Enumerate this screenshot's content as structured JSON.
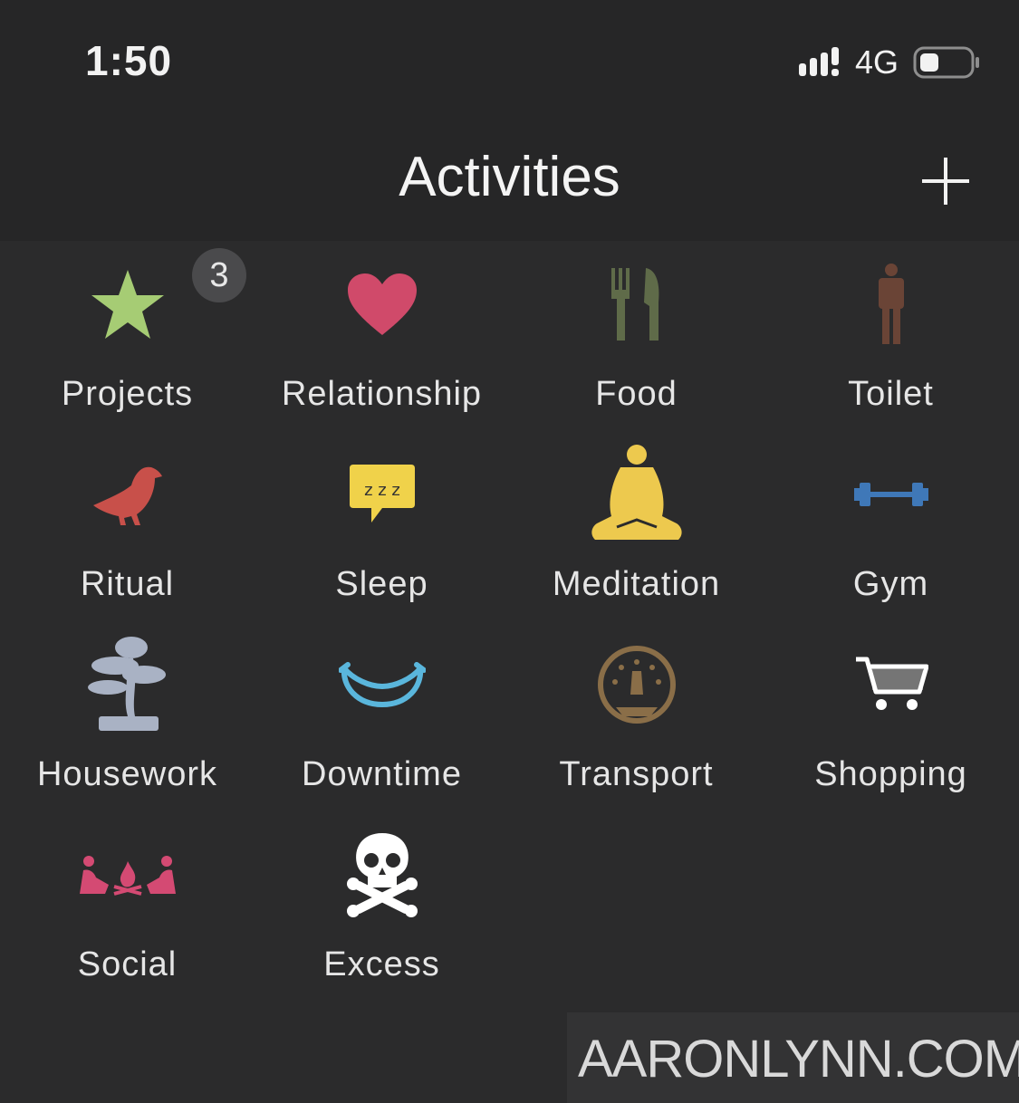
{
  "status": {
    "time": "1:50",
    "network": "4G"
  },
  "nav": {
    "title": "Activities",
    "add_icon": "plus-icon"
  },
  "activities": [
    {
      "label": "Projects",
      "icon": "star-icon",
      "color": "#a6cc74",
      "badge": "3"
    },
    {
      "label": "Relationship",
      "icon": "heart-icon",
      "color": "#d04a6a"
    },
    {
      "label": "Food",
      "icon": "fork-knife-icon",
      "color": "#5f6b49"
    },
    {
      "label": "Toilet",
      "icon": "person-icon",
      "color": "#6a4436"
    },
    {
      "label": "Ritual",
      "icon": "bird-icon",
      "color": "#c8504a"
    },
    {
      "label": "Sleep",
      "icon": "sleep-bubble-icon",
      "color": "#f0d24a",
      "icon_text": "z z z"
    },
    {
      "label": "Meditation",
      "icon": "meditation-icon",
      "color": "#edc94e"
    },
    {
      "label": "Gym",
      "icon": "dumbbell-icon",
      "color": "#3f78b8"
    },
    {
      "label": "Housework",
      "icon": "bonsai-icon",
      "color": "#a9b2c4"
    },
    {
      "label": "Downtime",
      "icon": "smile-icon",
      "color": "#5ab6dc"
    },
    {
      "label": "Transport",
      "icon": "speedometer-icon",
      "color": "#8a6e48"
    },
    {
      "label": "Shopping",
      "icon": "cart-icon",
      "color": "#ffffff"
    },
    {
      "label": "Social",
      "icon": "campfire-icon",
      "color": "#d44a73"
    },
    {
      "label": "Excess",
      "icon": "skull-crossbones-icon",
      "color": "#ffffff"
    }
  ],
  "watermark": "AARONLYNN.COM"
}
